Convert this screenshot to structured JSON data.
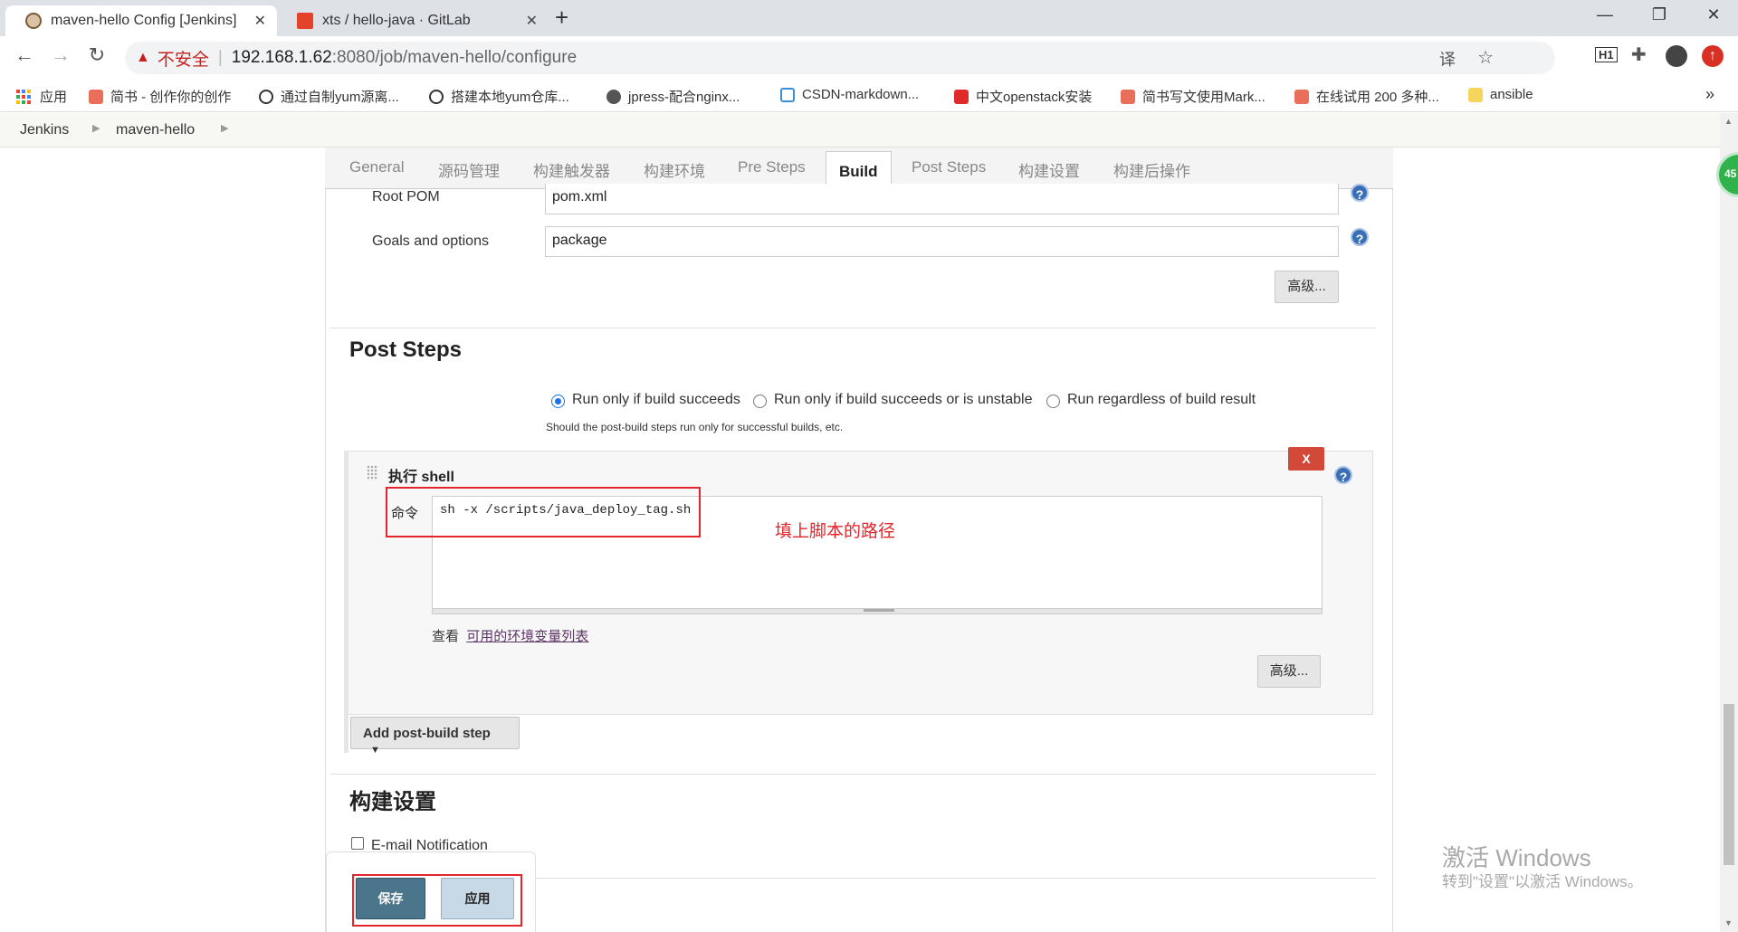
{
  "browser": {
    "tabs": [
      {
        "title": "maven-hello Config [Jenkins]",
        "active": true
      },
      {
        "title": "xts / hello-java · GitLab",
        "active": false
      }
    ],
    "security_label": "不安全",
    "url_host": "192.168.1.62",
    "url_rest": ":8080/job/maven-hello/configure",
    "bookmarks": [
      "应用",
      "简书 - 创作你的创作",
      "通过自制yum源离...",
      "搭建本地yum仓库...",
      "jpress-配合nginx...",
      "CSDN-markdown...",
      "中文openstack安装",
      "简书写文使用Mark...",
      "在线试用 200 多种...",
      "ansible"
    ],
    "bookmarks_more": "»"
  },
  "breadcrumb": [
    "Jenkins",
    "maven-hello"
  ],
  "config_tabs": [
    "General",
    "源码管理",
    "构建触发器",
    "构建环境",
    "Pre Steps",
    "Build",
    "Post Steps",
    "构建设置",
    "构建后操作"
  ],
  "build": {
    "root_pom_label": "Root POM",
    "root_pom_value": "pom.xml",
    "goals_label": "Goals and options",
    "goals_value": "package",
    "advanced_label": "高级..."
  },
  "post_steps": {
    "title": "Post Steps",
    "radios": [
      {
        "label": "Run only if build succeeds",
        "checked": true
      },
      {
        "label": "Run only if build succeeds or is unstable",
        "checked": false
      },
      {
        "label": "Run regardless of build result",
        "checked": false
      }
    ],
    "description": "Should the post-build steps run only for successful builds, etc.",
    "shell_title": "执行 shell",
    "delete_label": "X",
    "command_label": "命令",
    "command_value": "sh -x /scripts/java_deploy_tag.sh",
    "annotation": "填上脚本的路径",
    "env_prefix": "查看",
    "env_link": "可用的环境变量列表",
    "advanced_label": "高级...",
    "add_step_label": "Add post-build step"
  },
  "build_settings": {
    "title": "构建设置",
    "email_label": "E-mail Notification",
    "email_checked": false
  },
  "footer_buttons": {
    "save": "保存",
    "apply": "应用"
  },
  "watermark": {
    "line1": "激活 Windows",
    "line2": "转到\"设置\"以激活 Windows。"
  },
  "floating_badge": "45",
  "colors": {
    "accent_blue": "#1a73e8",
    "danger_red": "#d24939",
    "annotation_red": "#e4252b",
    "save_button": "#4b758b"
  }
}
